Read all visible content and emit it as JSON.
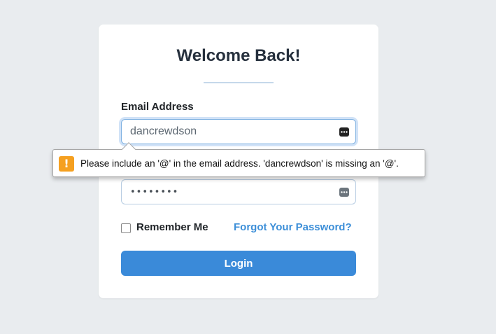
{
  "login": {
    "title": "Welcome Back!",
    "email_label": "Email Address",
    "email_value": "dancrewdson",
    "password_value": "••••••••",
    "remember_label": "Remember Me",
    "forgot_label": "Forgot Your Password?",
    "login_label": "Login"
  },
  "validation_tooltip": {
    "icon": "warning-icon",
    "message": "Please include an '@' in the email address. 'dancrewdson' is missing an '@'."
  },
  "colors": {
    "accent": "#3a8ad9",
    "link": "#3d8fd8",
    "warning": "#f5a020",
    "background": "#e9ecef"
  },
  "icons": {
    "field_autofill": "autofill-key-icon"
  }
}
